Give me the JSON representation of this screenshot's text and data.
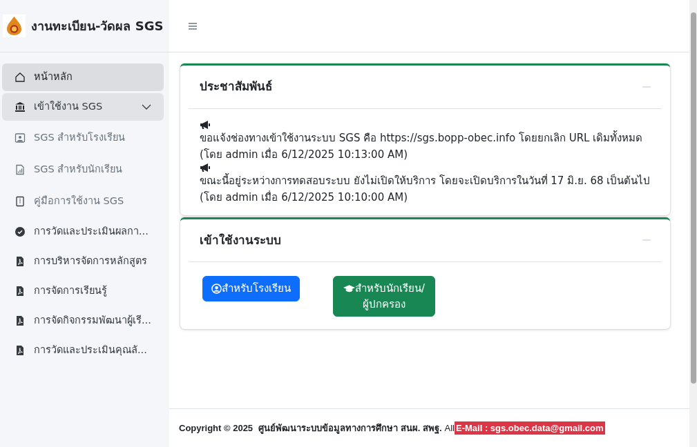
{
  "brand": {
    "title": "งานทะเบียน-วัดผล SGS"
  },
  "sidebar": {
    "items": [
      {
        "label": "หน้าหลัก",
        "selected": true
      },
      {
        "label": "เข้าใช้งาน SGS",
        "selected": false,
        "expanded": true,
        "children": [
          {
            "label": "SGS สำหรับโรงเรียน",
            "selected": false
          },
          {
            "label": "SGS สำหรับนักเรียน",
            "selected": false
          },
          {
            "label": "คู่มือการใช้งาน SGS",
            "selected": false
          }
        ]
      },
      {
        "label": "การวัดและประเมินผลกา...",
        "selected": false
      },
      {
        "label": "การบริหารจัดการหลักสูตร",
        "selected": false
      },
      {
        "label": "การจัดการเรียนรู้",
        "selected": false
      },
      {
        "label": "การจัดกิจกรรมพัฒนาผู้เรี...",
        "selected": false
      },
      {
        "label": "การวัดและประเมินคุณลั...",
        "selected": false
      }
    ]
  },
  "cards": [
    {
      "title": "ประชาสัมพันธ์",
      "kind": "news",
      "announcements": [
        {
          "text": "ขอแจ้งช่องทางเข้าใช้งานระบบ SGS คือ https://sgs.bopp-obec.info โดยยกเลิก URL เดิมทั้งหมด (โดย admin เมื่อ 6/12/2025 10:13:00 AM)"
        },
        {
          "text": "ขณะนี้อยู่ระหว่างการทดสอบระบบ ยังไม่เปิดให้บริการ โดยจะเปิดบริการในวันที่ 17 มิ.ย. 68 เป็นต้นไป (โดย admin เมื่อ 6/12/2025 10:10:00 AM)"
        }
      ]
    },
    {
      "title": "เข้าใช้งานระบบ",
      "kind": "login",
      "buttons": [
        {
          "label": "สำหรับโรงเรียน",
          "kind": "school"
        },
        {
          "label": "สำหรับนักเรียน/ผู้ปกครอง",
          "kind": "student"
        }
      ]
    }
  ],
  "footer": {
    "copyright": "Copyright © 2025",
    "org": "ศูนย์พัฒนาระบบข้อมูลทางการศึกษา สนผ. สพฐ.",
    "rights": "All",
    "email": "E-Mail : sgs.obec.data@gmail.com"
  }
}
